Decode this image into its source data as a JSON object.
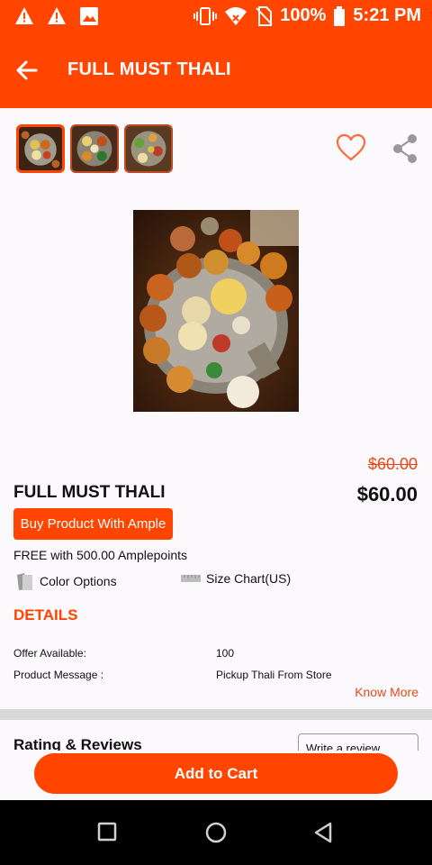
{
  "status_bar": {
    "battery": "100%",
    "time": "5:21 PM",
    "icons": [
      "warning-icon",
      "warning-icon",
      "image-icon",
      "vibrate-icon",
      "wifi-icon",
      "no-sim-icon",
      "battery-icon"
    ]
  },
  "app_bar": {
    "title": "FULL MUST THALI"
  },
  "product": {
    "old_price": "$60.00",
    "name": "FULL MUST THALI",
    "price": "$60.00",
    "buy_button": "Buy Product With Ample",
    "free_text": "FREE with 500.00 Amplepoints",
    "color_options": "Color Options",
    "size_chart": "Size Chart(US)"
  },
  "details": {
    "heading": "DETAILS",
    "rows": [
      {
        "label": "Offer Available:",
        "value": "100"
      },
      {
        "label": "Product Message :",
        "value": "Pickup Thali From Store"
      }
    ],
    "know_more": "Know More"
  },
  "reviews": {
    "heading": "Rating & Reviews",
    "write_button": "Write a review"
  },
  "cart": {
    "add_button": "Add to Cart"
  },
  "colors": {
    "accent": "#ff4500",
    "price_strike": "#e64a19"
  }
}
